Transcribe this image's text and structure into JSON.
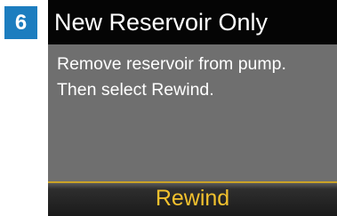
{
  "step": {
    "number": "6"
  },
  "screen": {
    "title": "New Reservoir Only",
    "message_lines": [
      "Remove reservoir from pump.",
      "Then select Rewind."
    ],
    "action_label": "Rewind"
  },
  "colors": {
    "step_badge": "#1c7dbf",
    "title_bar": "#050505",
    "screen_background": "#6f6f6f",
    "action_text": "#f2c12e",
    "action_border": "#c9a227"
  }
}
